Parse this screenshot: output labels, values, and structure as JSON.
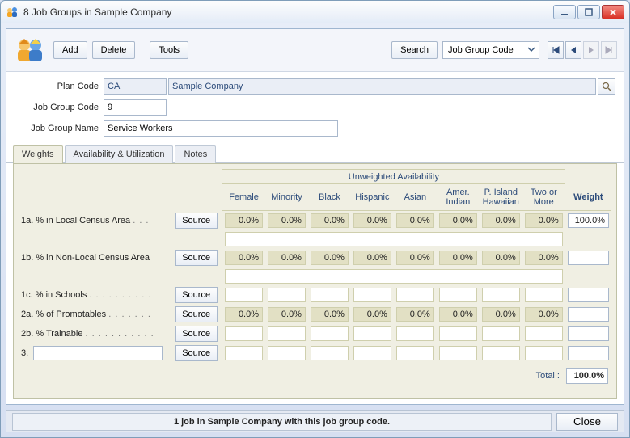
{
  "window": {
    "title": "8 Job Groups in Sample Company"
  },
  "toolbar": {
    "add_label": "Add",
    "delete_label": "Delete",
    "tools_label": "Tools",
    "search_label": "Search",
    "search_select": "Job Group Code"
  },
  "form": {
    "plan_code_label": "Plan Code",
    "plan_code_value": "CA",
    "plan_code_desc": "Sample Company",
    "job_group_code_label": "Job Group Code",
    "job_group_code_value": "9",
    "job_group_name_label": "Job Group Name",
    "job_group_name_value": "Service Workers"
  },
  "tabs": {
    "weights": "Weights",
    "availability": "Availability & Utilization",
    "notes": "Notes"
  },
  "grid": {
    "group_header": "Unweighted Availability",
    "columns": [
      "Female",
      "Minority",
      "Black",
      "Hispanic",
      "Asian",
      "Amer. Indian",
      "P. Island Hawaiian",
      "Two or More"
    ],
    "weight_header": "Weight",
    "source_label": "Source",
    "rows": [
      {
        "id": "1a",
        "label": "1a.  % in Local Census Area",
        "has_values": true,
        "values": [
          "0.0%",
          "0.0%",
          "0.0%",
          "0.0%",
          "0.0%",
          "0.0%",
          "0.0%",
          "0.0%"
        ],
        "weight": "100.0%",
        "spacer_after": true
      },
      {
        "id": "1b",
        "label": "1b.  % in Non-Local Census Area",
        "has_values": true,
        "values": [
          "0.0%",
          "0.0%",
          "0.0%",
          "0.0%",
          "0.0%",
          "0.0%",
          "0.0%",
          "0.0%"
        ],
        "weight": "",
        "spacer_after": true
      },
      {
        "id": "1c",
        "label": "1c.  % in Schools",
        "has_values": false,
        "weight": ""
      },
      {
        "id": "2a",
        "label": "2a.  % of Promotables",
        "has_values": true,
        "values": [
          "0.0%",
          "0.0%",
          "0.0%",
          "0.0%",
          "0.0%",
          "0.0%",
          "0.0%",
          "0.0%"
        ],
        "weight": ""
      },
      {
        "id": "2b",
        "label": "2b.  % Trainable",
        "has_values": false,
        "weight": ""
      },
      {
        "id": "3",
        "label": "3.",
        "custom_input": true,
        "has_values": false,
        "weight": ""
      }
    ],
    "total_label": "Total :",
    "total_value": "100.0%"
  },
  "status": {
    "text": "1 job in Sample Company with this job group code.",
    "close_label": "Close"
  }
}
